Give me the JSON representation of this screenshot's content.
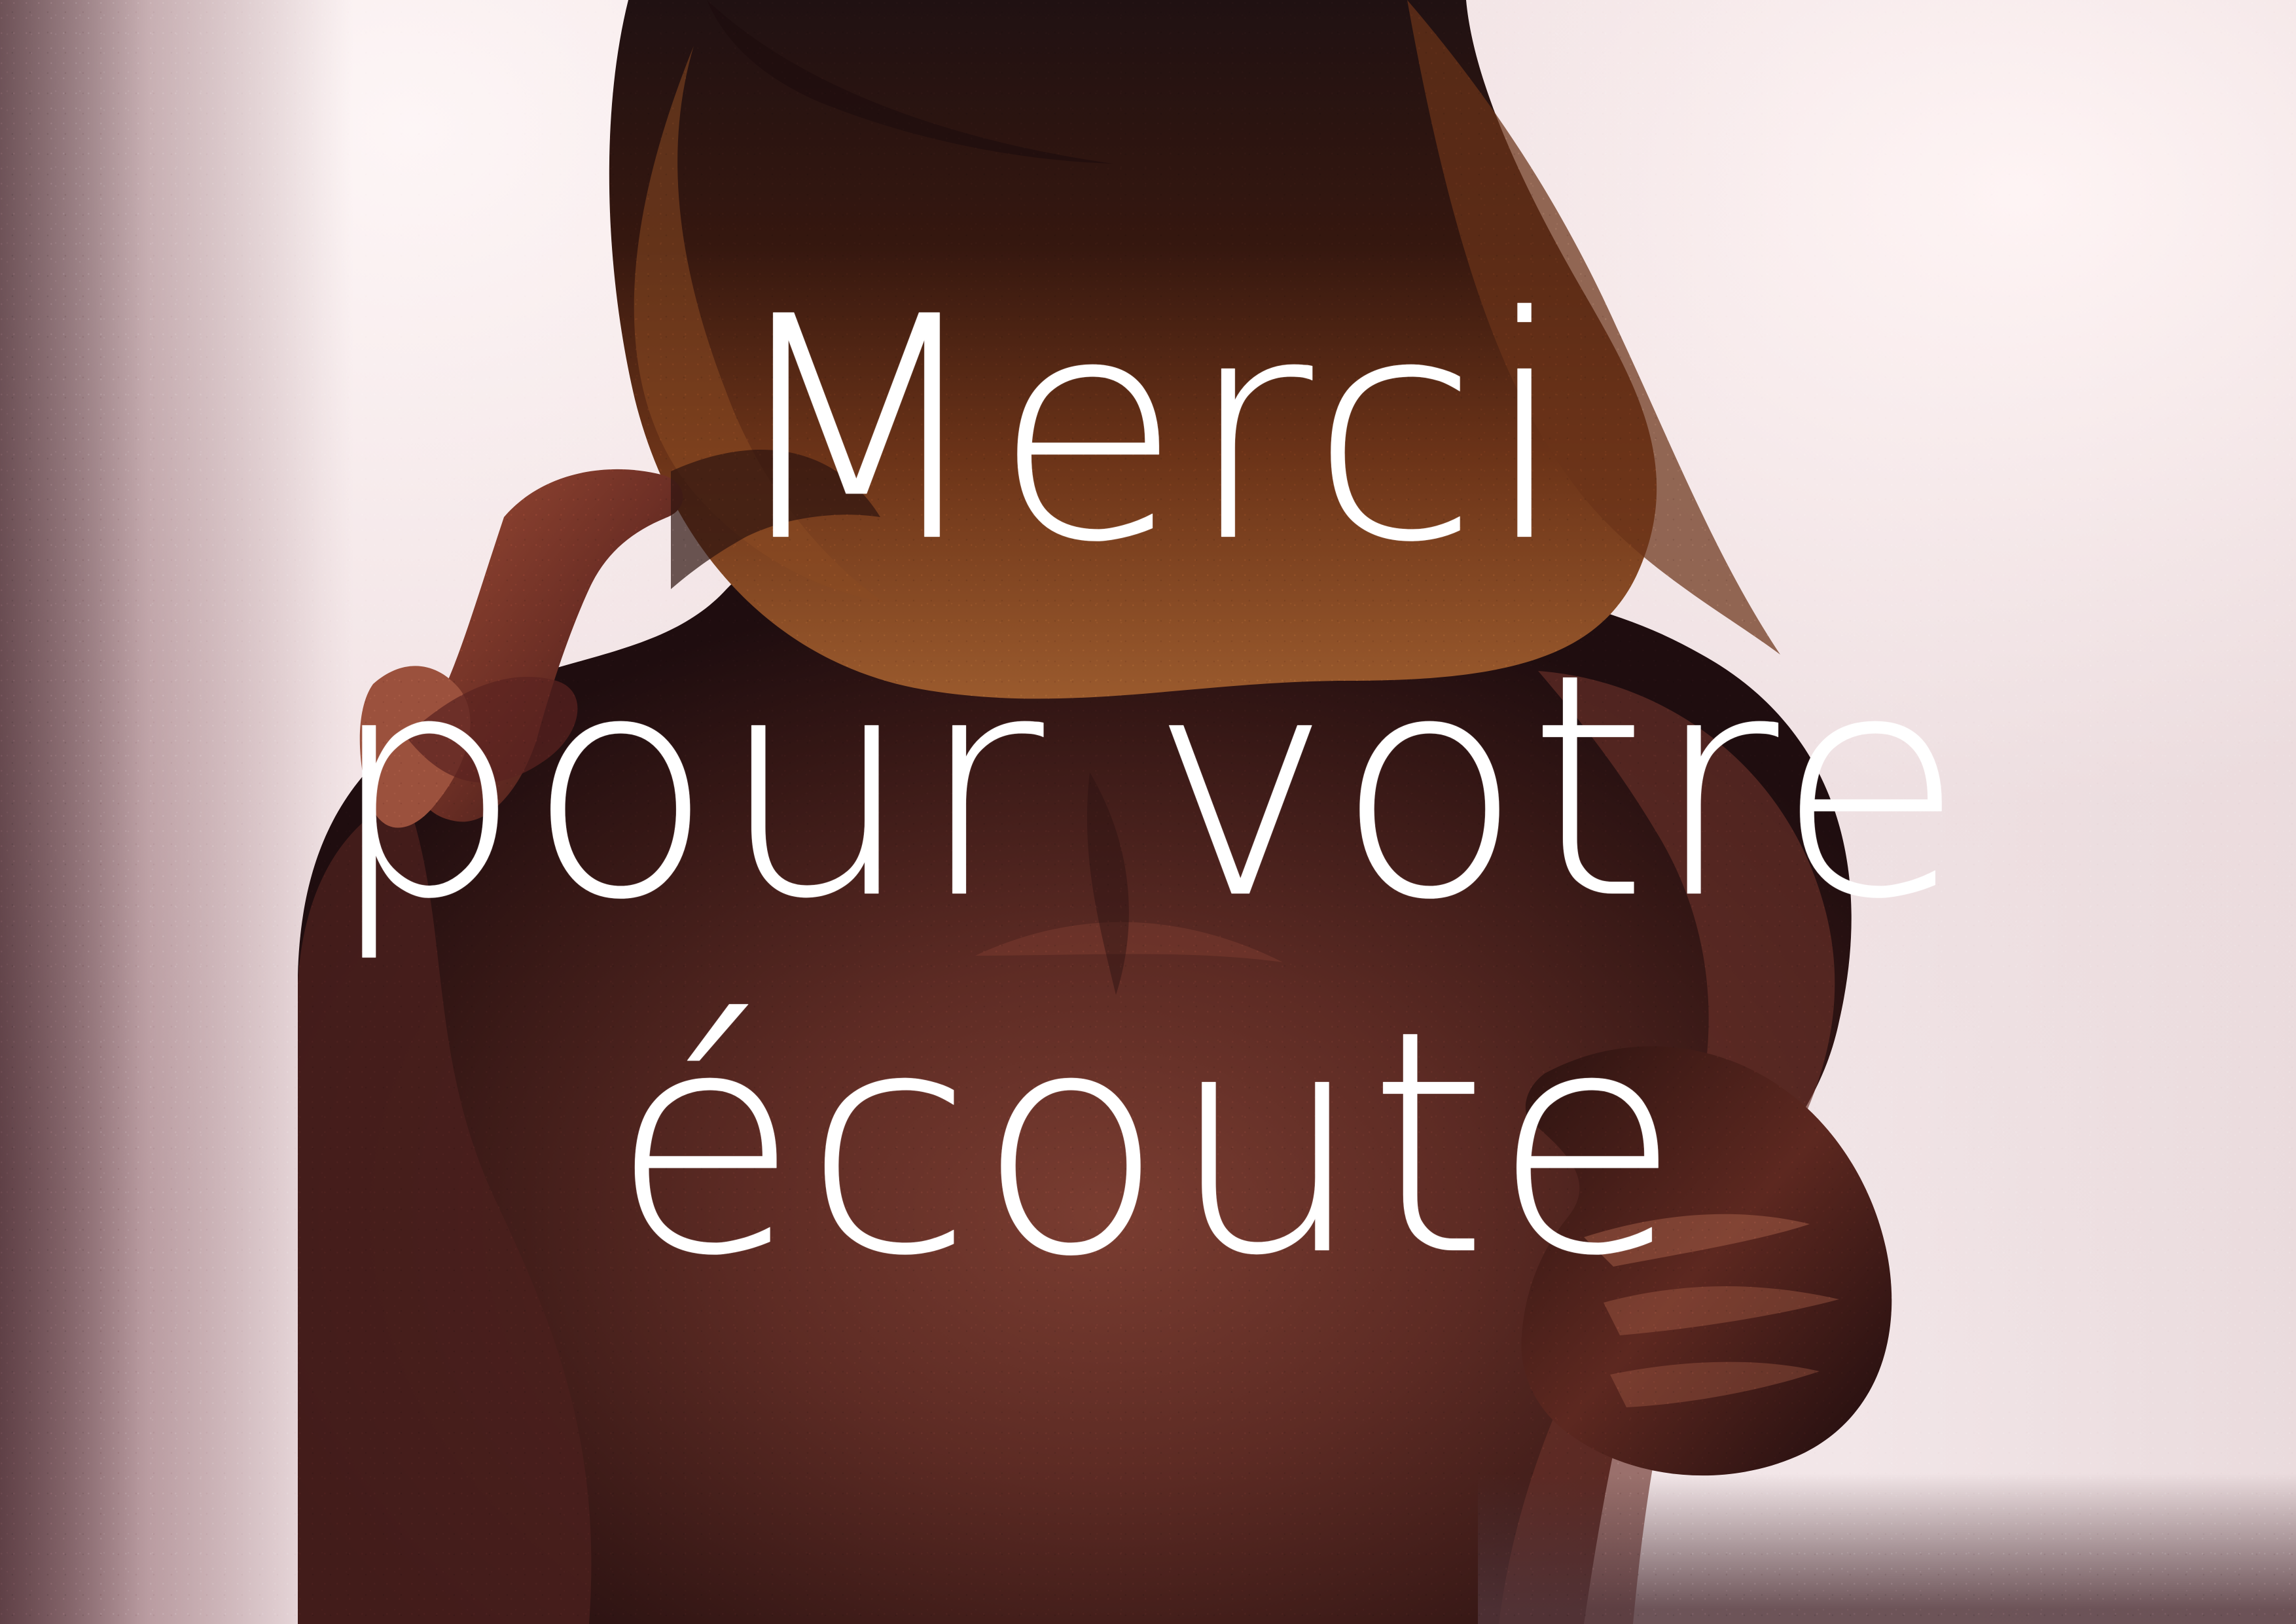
{
  "scene": {
    "description_icon": "figure-back-photo",
    "background_color": "#efe2e3",
    "skin_tone": "#5b2a22",
    "hair_tone": "#2d1810",
    "text_color": "#ffffff"
  },
  "title": {
    "line1": "Merci",
    "line2": "pour votre",
    "line3": "écoute"
  }
}
